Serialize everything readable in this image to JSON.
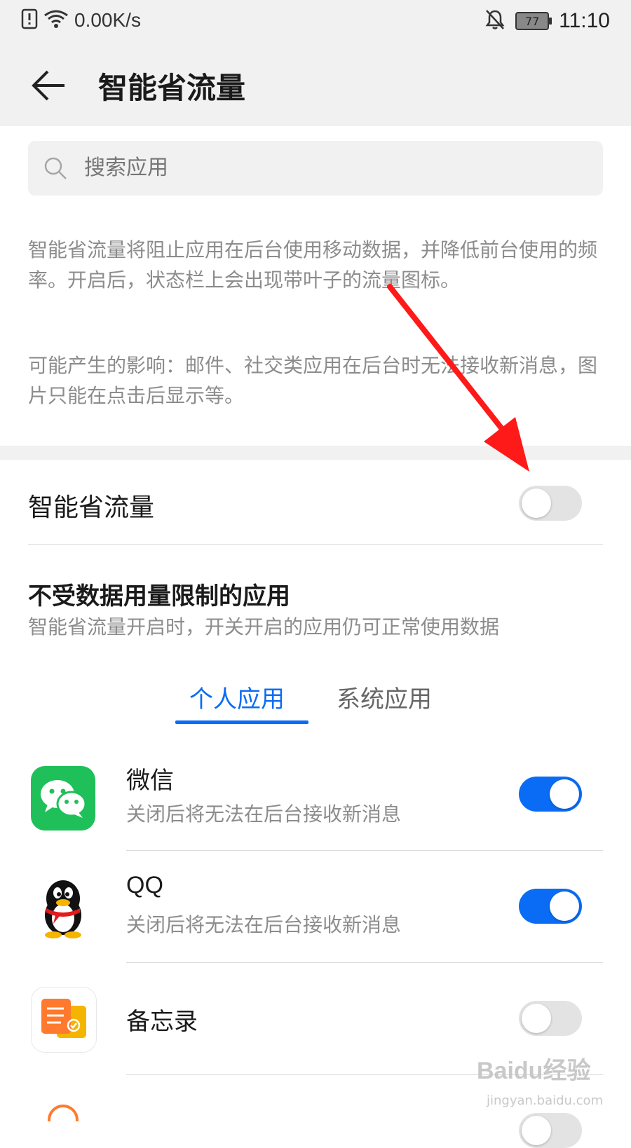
{
  "status_bar": {
    "speed": "0.00K/s",
    "battery": "77",
    "time": "11:10"
  },
  "header": {
    "title": "智能省流量"
  },
  "search": {
    "placeholder": "搜索应用"
  },
  "description": {
    "paragraph1": "智能省流量将阻止应用在后台使用移动数据，并降低前台使用的频率。开启后，状态栏上会出现带叶子的流量图标。",
    "paragraph2": "可能产生的影响：邮件、社交类应用在后台时无法接收新消息，图片只能在点击后显示等。"
  },
  "main_toggle": {
    "label": "智能省流量",
    "state": "off"
  },
  "unrestricted": {
    "title": "不受数据用量限制的应用",
    "subtitle": "智能省流量开启时，开关开启的应用仍可正常使用数据"
  },
  "tabs": [
    {
      "label": "个人应用",
      "active": true
    },
    {
      "label": "系统应用",
      "active": false
    }
  ],
  "apps": [
    {
      "name": "微信",
      "desc": "关闭后将无法在后台接收新消息",
      "state": "on",
      "icon": "wechat-icon"
    },
    {
      "name": "QQ",
      "desc": "关闭后将无法在后台接收新消息",
      "state": "on",
      "icon": "qq-icon"
    },
    {
      "name": "备忘录",
      "desc": "",
      "state": "off",
      "icon": "notes-icon"
    }
  ],
  "colors": {
    "accent": "#0a6cf5",
    "toggle_off": "#e3e3e3",
    "header_bg": "#f1f1f1",
    "secondary_text": "#8c8c8c",
    "annotation_arrow": "#ff1a1a"
  },
  "watermark": {
    "text": "Baidu经验",
    "url": "jingyan.baidu.com"
  }
}
